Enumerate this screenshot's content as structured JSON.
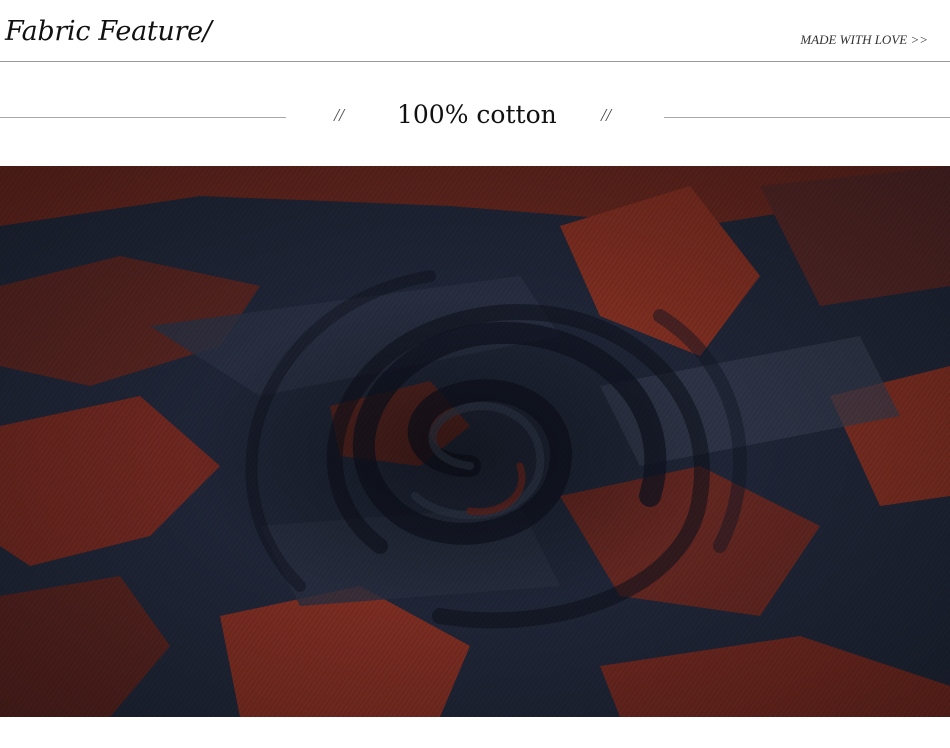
{
  "header": {
    "title": "Fabric Feature/",
    "tagline": "MADE WITH LOVE >>"
  },
  "section": {
    "left_mark": "//",
    "material": "100% cotton",
    "right_mark": "//"
  },
  "photo": {
    "subject": "swirled red and navy plaid knit fabric",
    "colors": {
      "navy": "#1f2436",
      "rust": "#8a2e22",
      "heather": "#5a6275"
    }
  }
}
